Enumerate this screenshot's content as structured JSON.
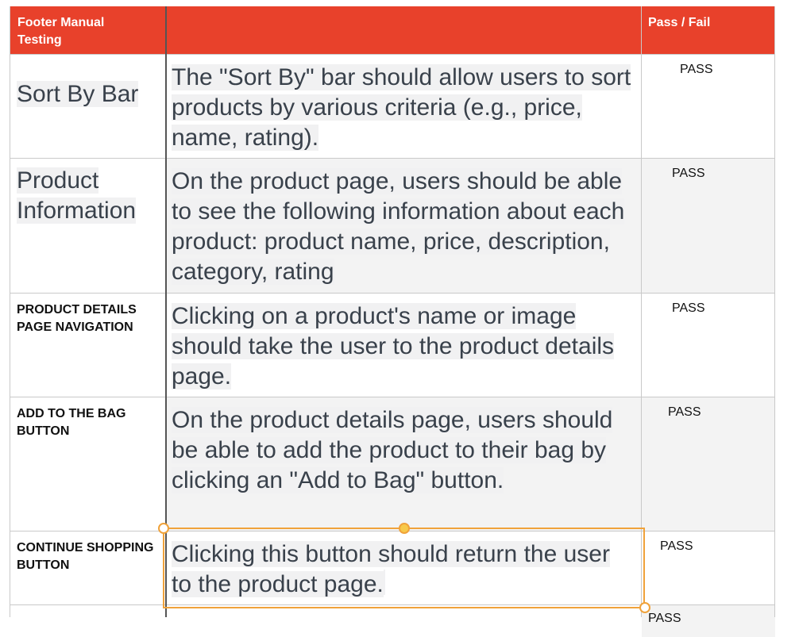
{
  "header": {
    "col1": "Footer Manual Testing",
    "col2": "",
    "col3": "Pass / Fail"
  },
  "rows": [
    {
      "name": "Sort By Bar",
      "desc": "The \"Sort By\" bar should allow users to sort products by various criteria (e.g., price, name, rating).",
      "status": "PASS"
    },
    {
      "name": "Product Information",
      "desc": "On the product page, users should be able to see the following information about each product: product name, price, description, category, rating",
      "status": "PASS"
    },
    {
      "name": "PRODUCT DETAILS PAGE NAVIGATION",
      "desc": "Clicking on a product's name or image should take the user to the product details page.",
      "status": "PASS"
    },
    {
      "name": "ADD TO THE BAG BUTTON",
      "desc": "On the product details page, users should be able to add the product to their bag by clicking an \"Add to Bag\" button.",
      "status": "PASS"
    },
    {
      "name": "CONTINUE SHOPPING BUTTON",
      "desc": "Clicking this button should return the user to the product page.",
      "status": "PASS"
    },
    {
      "status": "PASS"
    }
  ],
  "colors": {
    "header_bg": "#e8412b",
    "selection": "#f0a23a"
  }
}
